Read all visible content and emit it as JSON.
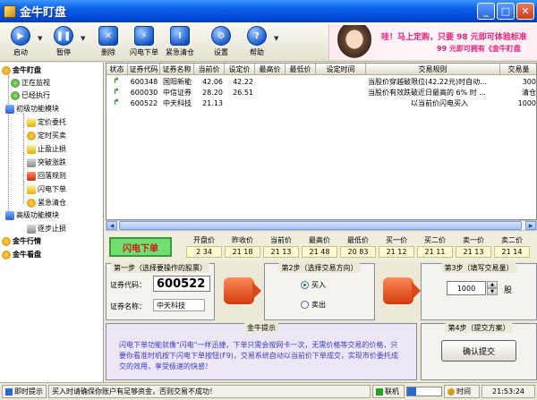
{
  "window": {
    "title": "金牛盯盘"
  },
  "toolbar": {
    "start_label": "启动",
    "pause_label": "暂停",
    "delete_label": "删除",
    "flash_order_label": "闪电下单",
    "clear_positions_label": "紧急清仓",
    "settings_label": "设置",
    "help_label": "帮助"
  },
  "ad": {
    "line1": "哇！马上定购，只要 98 元即可体验标准",
    "line2": "99 元即可拥有《金牛盯盘"
  },
  "tree": {
    "root": "金牛盯盘",
    "watching": "正在监视",
    "executed": "已经执行",
    "module": "初级功能模块",
    "items": [
      "定价委托",
      "定时买卖",
      "止盈止损",
      "突破涨跌",
      "回落规则",
      "闪电下单",
      "紧急清仓"
    ],
    "advanced": "高级功能模块",
    "step_stop": "逐步止损",
    "market": "金牛行情",
    "news": "金牛看盘"
  },
  "grid": {
    "headers": [
      "状态",
      "证券代码",
      "证券名称",
      "当前价",
      "设定价",
      "最高价",
      "最低价",
      "设定时间",
      "交易规则",
      "交易量"
    ],
    "rows": [
      {
        "code": "600348",
        "name": "国阳新能",
        "current": "42.06",
        "set": "42.22",
        "high": "",
        "low": "",
        "time": "",
        "rule": "当股价穿越破限位(42.22元)时自动...",
        "qty": "300"
      },
      {
        "code": "600030",
        "name": "中信证券",
        "current": "28.20",
        "set": "26.51",
        "high": "",
        "low": "",
        "time": "",
        "rule": "当股价有效跌破近日最高的 6% 时 ...",
        "qty": "清仓"
      },
      {
        "code": "600522",
        "name": "中天科技",
        "current": "21.13",
        "set": "",
        "high": "",
        "low": "",
        "time": "",
        "rule": "以当前价闪电买入",
        "qty": "1000"
      }
    ]
  },
  "quote": {
    "flash_button": "闪电下单",
    "labels": [
      "开盘价",
      "昨收价",
      "当前价",
      "最高价",
      "最低价",
      "买一价",
      "买二价",
      "卖一价",
      "卖二价"
    ],
    "values": [
      "2 34",
      "21 18",
      "21 13",
      "21 48",
      "20 83",
      "21 12",
      "21 11",
      "21 13",
      "21 14"
    ]
  },
  "step1": {
    "title": "第一步（选择要操作的股票）",
    "code_label": "证券代码：",
    "code_value": "600522",
    "name_label": "证券名称：",
    "name_value": "中天科技"
  },
  "step2": {
    "title": "第2步（选择交易方向）",
    "buy": "买入",
    "sell": "卖出"
  },
  "step3": {
    "title": "第3步（填写交易量）",
    "qty": "1000",
    "unit": "股"
  },
  "step4": {
    "title": "第4步（提交方案）",
    "confirm": "确认提交"
  },
  "tips": {
    "title": "金牛提示",
    "text": "闪电下单功能就像\"闪电\"一样迅捷，下单只需会按网卡一次，无需价格等交易的价格，只要你看准时机按下闪电下单按钮(F9)，交易系统自动以当前价下单成交，实现市价委托成交的效用，享受极速的快感！"
  },
  "status": {
    "label": "即时提示",
    "message": "买入时请确保你账户有足够资金，否则交易不成功！",
    "online": "联机",
    "time_label": "时间",
    "time": "21:53:24"
  },
  "progress": 0.25
}
